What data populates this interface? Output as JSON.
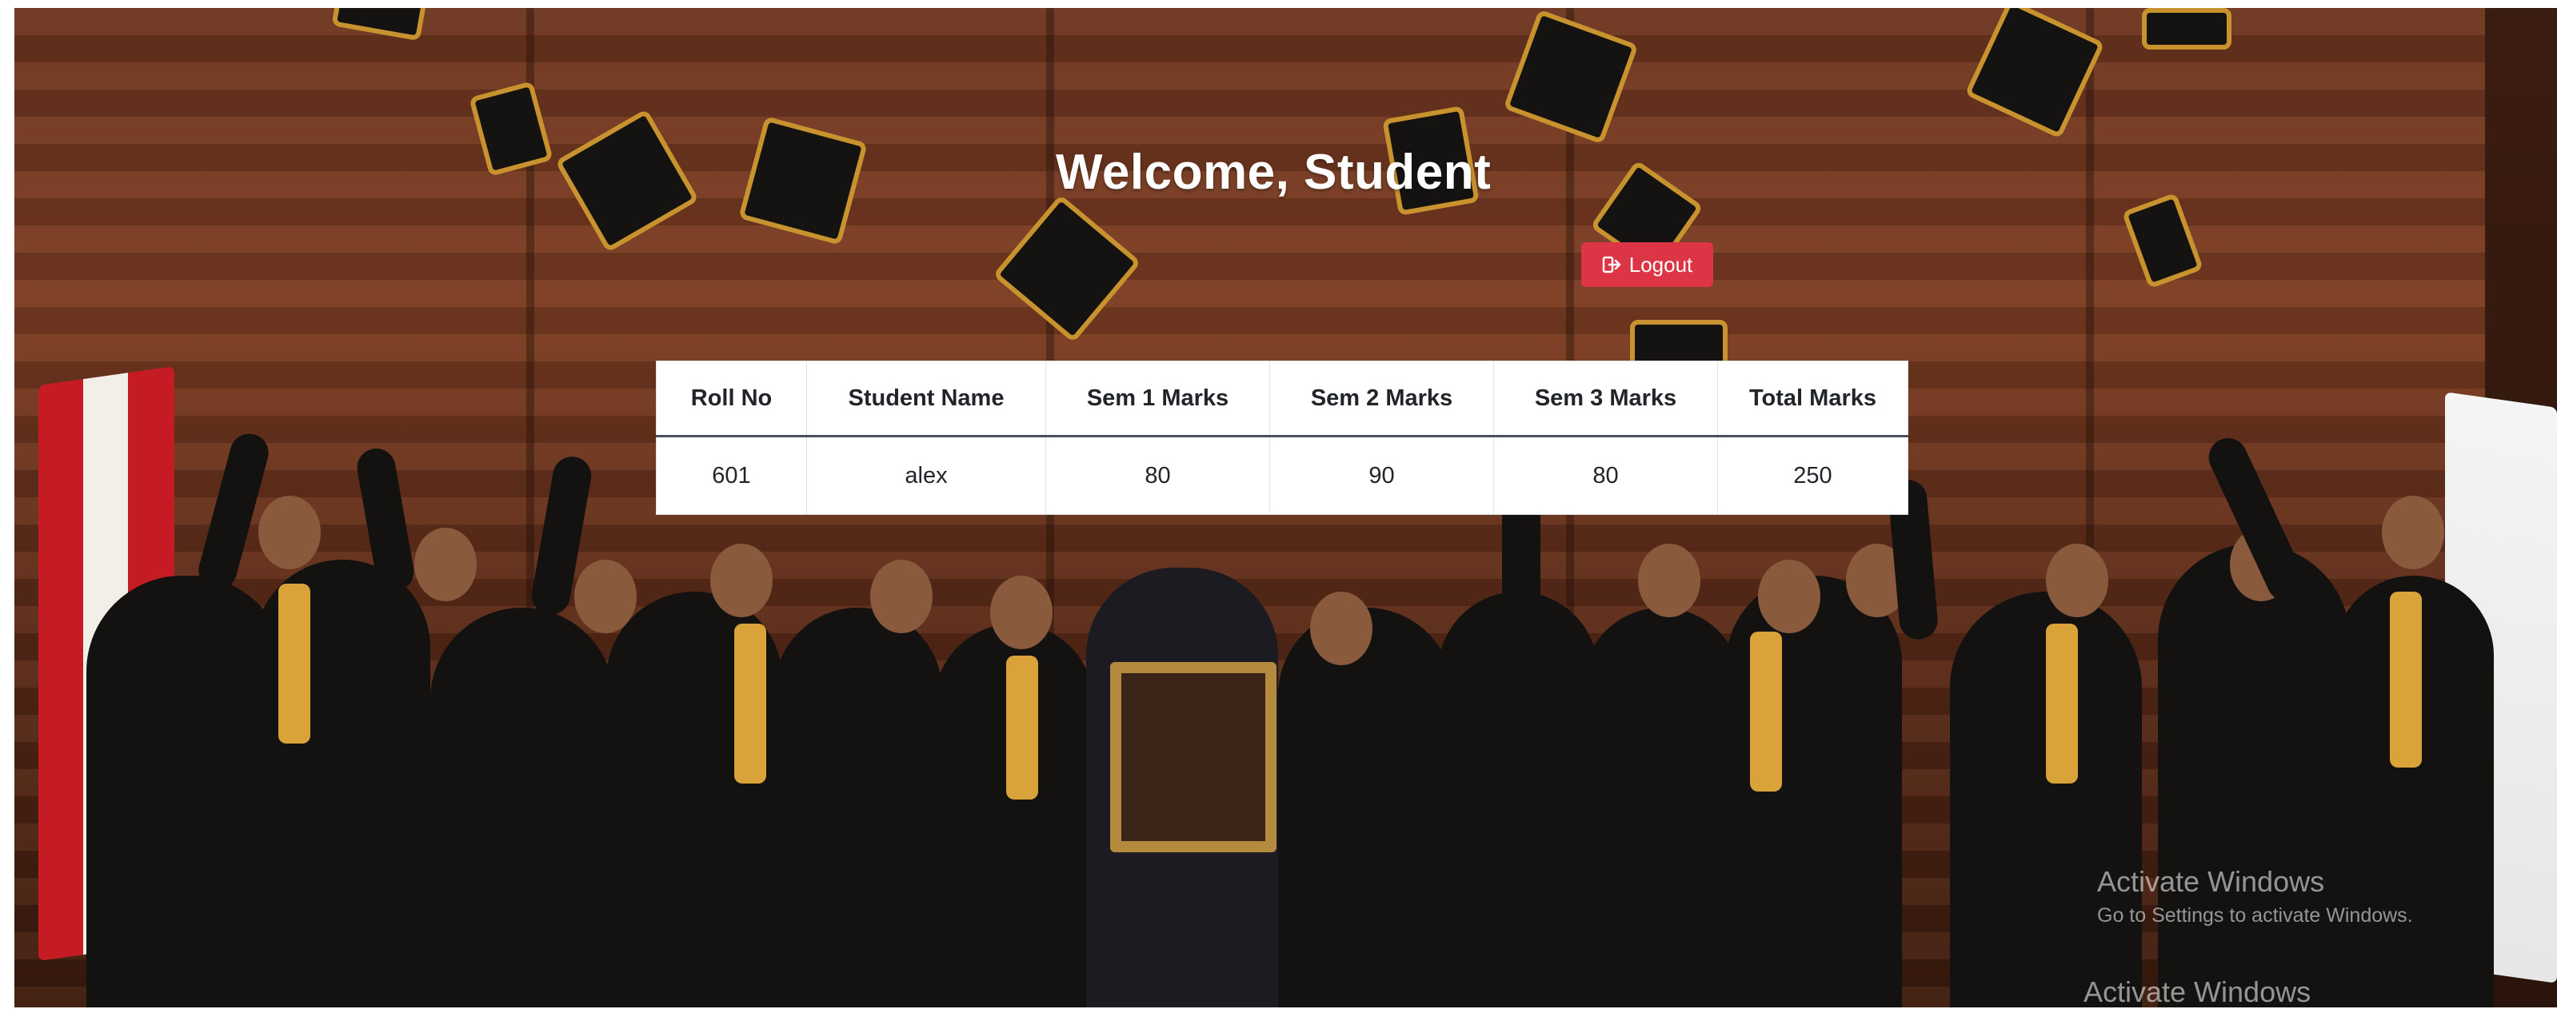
{
  "header": {
    "title": "Welcome, Student",
    "logout_label": "Logout"
  },
  "marks_table": {
    "columns": [
      "Roll No",
      "Student Name",
      "Sem 1 Marks",
      "Sem 2 Marks",
      "Sem 3 Marks",
      "Total Marks"
    ],
    "rows": [
      [
        "601",
        "alex",
        "80",
        "90",
        "80",
        "250"
      ]
    ]
  },
  "watermark": {
    "line1": "Activate Windows",
    "line2": "Go to Settings to activate Windows.",
    "line3": "Activate Windows"
  },
  "colors": {
    "logout_button": "#dc3545",
    "title_text": "#ffffff",
    "table_background": "#ffffff"
  },
  "icons": {
    "logout": "sign-out-icon"
  }
}
